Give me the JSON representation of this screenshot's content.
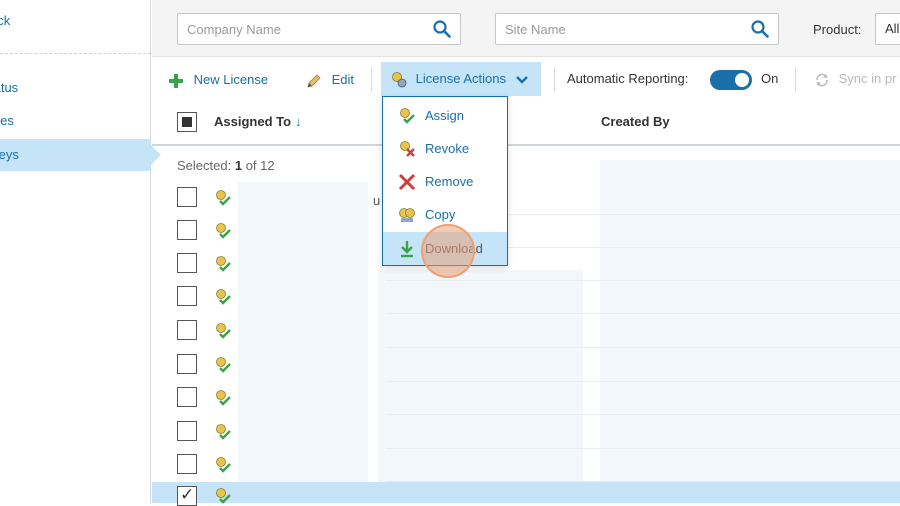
{
  "sidebar": {
    "items": [
      {
        "label": "ack"
      },
      {
        "label": "tatus"
      },
      {
        "label": "nies"
      },
      {
        "label": "Keys"
      }
    ]
  },
  "filters": {
    "company_placeholder": "Company Name",
    "site_placeholder": "Site Name",
    "product_label": "Product:",
    "product_value": "All"
  },
  "toolbar": {
    "new_license": "New License",
    "edit": "Edit",
    "license_actions": "License Actions",
    "auto_reporting_label": "Automatic Reporting:",
    "auto_reporting_state": "On",
    "sync": "Sync in pr"
  },
  "table": {
    "columns": {
      "assigned_to": "Assigned To",
      "created_by": "Created By"
    },
    "selected_label": "Selected:",
    "selected_count": "1",
    "selected_of": "of 12",
    "partial_text": "u"
  },
  "menu": {
    "items": [
      {
        "label": "Assign"
      },
      {
        "label": "Revoke"
      },
      {
        "label": "Remove"
      },
      {
        "label": "Copy"
      },
      {
        "label": "Download"
      }
    ]
  },
  "colors": {
    "accent": "#1a6fa8",
    "highlight": "#c5e4f7"
  }
}
